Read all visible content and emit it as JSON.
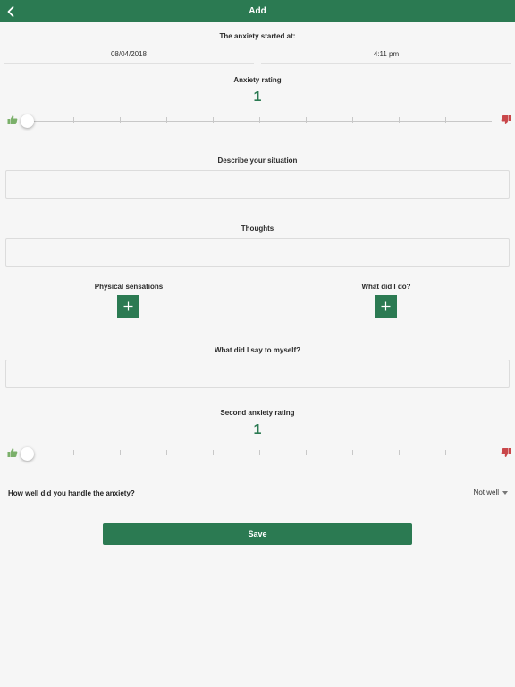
{
  "header": {
    "title": "Add",
    "back_icon": "chevron-left-icon"
  },
  "started": {
    "label": "The anxiety started at:",
    "date": "08/04/2018",
    "time": "4:11 pm"
  },
  "anxiety_rating": {
    "label": "Anxiety rating",
    "value": "1",
    "slider_fraction": 0.0,
    "ticks": 9,
    "good_icon": "thumbs-up-icon",
    "bad_icon": "thumbs-down-icon"
  },
  "situation": {
    "label": "Describe your situation",
    "value": ""
  },
  "thoughts": {
    "label": "Thoughts",
    "value": ""
  },
  "physical": {
    "label": "Physical sensations",
    "button_icon": "plus-icon"
  },
  "did": {
    "label": "What did I do?",
    "button_icon": "plus-icon"
  },
  "self_talk": {
    "label": "What did I say to myself?",
    "value": ""
  },
  "second_rating": {
    "label": "Second anxiety rating",
    "value": "1",
    "slider_fraction": 0.0,
    "ticks": 9
  },
  "handle": {
    "question": "How well did you handle the anxiety?",
    "selected": "Not well"
  },
  "save": {
    "label": "Save"
  },
  "colors": {
    "primary": "#2b7a52",
    "good": "#7bb06a",
    "bad": "#c9474a",
    "background": "#f6f6f6"
  }
}
